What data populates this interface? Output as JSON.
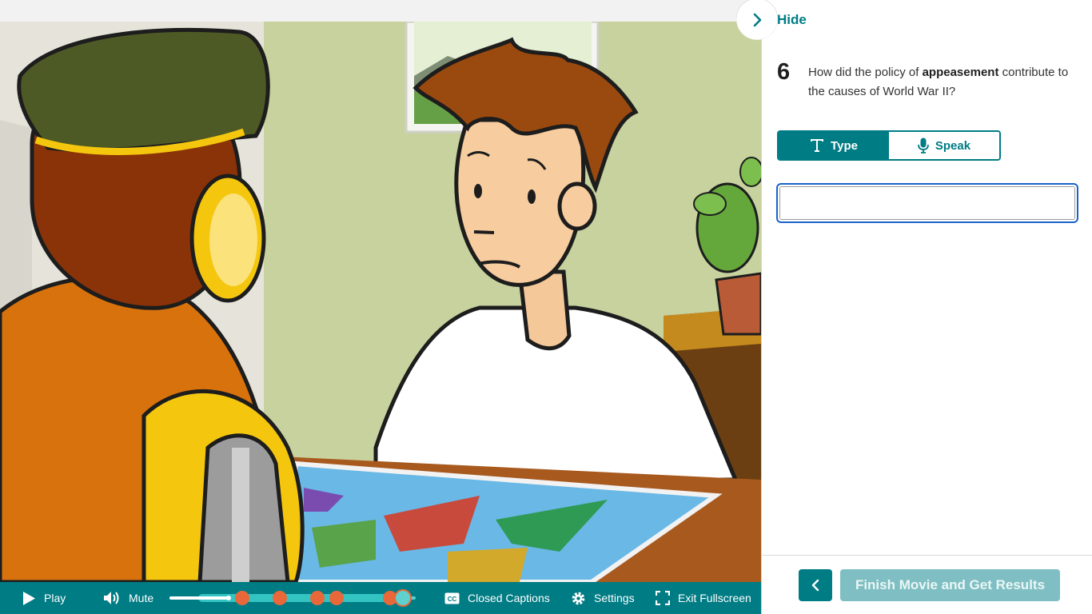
{
  "panel": {
    "hide_label": "Hide",
    "question": {
      "number": "6",
      "text_before": "How did the policy of ",
      "text_bold": "appeasement",
      "text_after": " contribute to the causes of World War II?"
    },
    "mode_toggle": {
      "type_label": "Type",
      "speak_label": "Speak",
      "selected": "Type"
    },
    "answer": {
      "value": ""
    },
    "footer": {
      "back_icon": "chevron-left-icon",
      "finish_label": "Finish Movie and Get Results"
    }
  },
  "player": {
    "play_label": "Play",
    "mute_label": "Mute",
    "captions_label": "Closed Captions",
    "settings_label": "Settings",
    "fullscreen_label": "Exit Fullscreen",
    "progress_fraction": 0.24,
    "chapter_marker_count": 6
  },
  "colors": {
    "teal": "#007c84",
    "teal_light": "#5ed1cf",
    "marker_orange": "#e8683a",
    "focus_blue": "#1a63c7",
    "finish_disabled": "#7fbfc3"
  }
}
